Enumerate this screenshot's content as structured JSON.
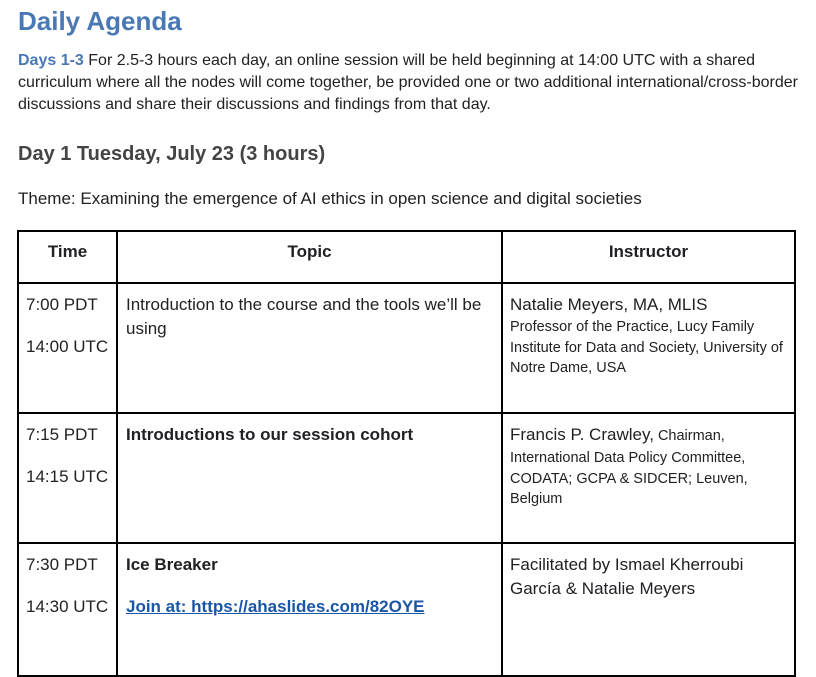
{
  "title": "Daily Agenda",
  "intro": {
    "days_label": "Days 1-3",
    "text": " For 2.5-3 hours each day, an online session will be held beginning at 14:00 UTC with a shared curriculum where all the nodes will come together, be provided one or two additional international/cross-border discussions and share their discussions and findings from that day."
  },
  "day_heading": "Day 1 Tuesday, July 23 (3 hours)",
  "theme": "Theme:  Examining the emergence of AI ethics in open science and digital societies",
  "table": {
    "headers": {
      "time": "Time",
      "topic": "Topic",
      "instructor": "Instructor"
    },
    "rows": [
      {
        "time_pdt": "7:00 PDT",
        "time_utc": "14:00 UTC",
        "topic": "Introduction to the course and the tools we’ll be using",
        "instructor_name": "Natalie Meyers, MA, MLIS",
        "instructor_affiliation": "Professor of the Practice, Lucy Family Institute for Data and Society, University of Notre Dame, USA"
      },
      {
        "time_pdt": "7:15 PDT",
        "time_utc": "14:15 UTC",
        "topic": "Introductions to our session cohort",
        "instructor_name": "Francis P. Crawley,",
        "instructor_affiliation_lead": " Chairman,",
        "instructor_affiliation": "International Data Policy Committee, CODATA; GCPA & SIDCER; Leuven, Belgium"
      },
      {
        "time_pdt": "7:30 PDT",
        "time_utc": "14:30 UTC",
        "topic": "Ice Breaker",
        "link_text": "Join at: https://ahaslides.com/82OYE",
        "instructor_name": "Facilitated by Ismael Kherroubi García & Natalie Meyers"
      }
    ]
  },
  "colors": {
    "heading_blue": "#4a78b5",
    "link_blue": "#1a56a8",
    "text": "#202124"
  }
}
